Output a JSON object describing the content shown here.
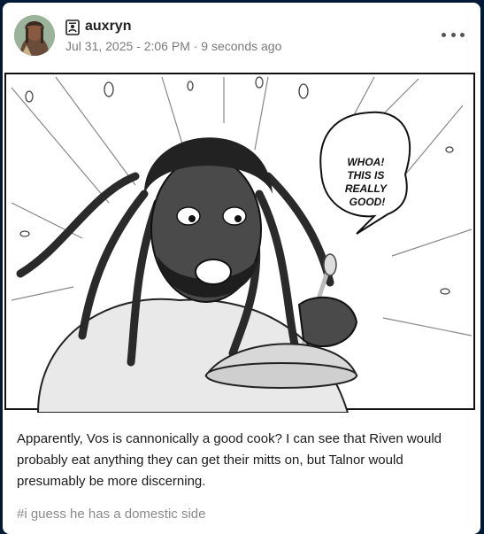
{
  "post": {
    "blog_name": "auxryn",
    "timestamp": "Jul 31, 2025 - 2:06 PM · 9 seconds ago",
    "body": "Apparently, Vos is cannonically a good cook?  I can see that Riven would probably eat anything they can get their mitts on, but Talnor would presumably be more discerning.",
    "tags": [
      "#i guess he has a domestic side"
    ]
  },
  "comic": {
    "speech_bubble": [
      "WHOA!",
      "THIS IS",
      "REALLY",
      "GOOD!"
    ]
  },
  "icons": {
    "blog": "blog-icon",
    "more": "more-options-icon"
  },
  "colors": {
    "page_background": "#001935",
    "card_background": "#ffffff",
    "secondary_text": "#7a7a7a"
  }
}
